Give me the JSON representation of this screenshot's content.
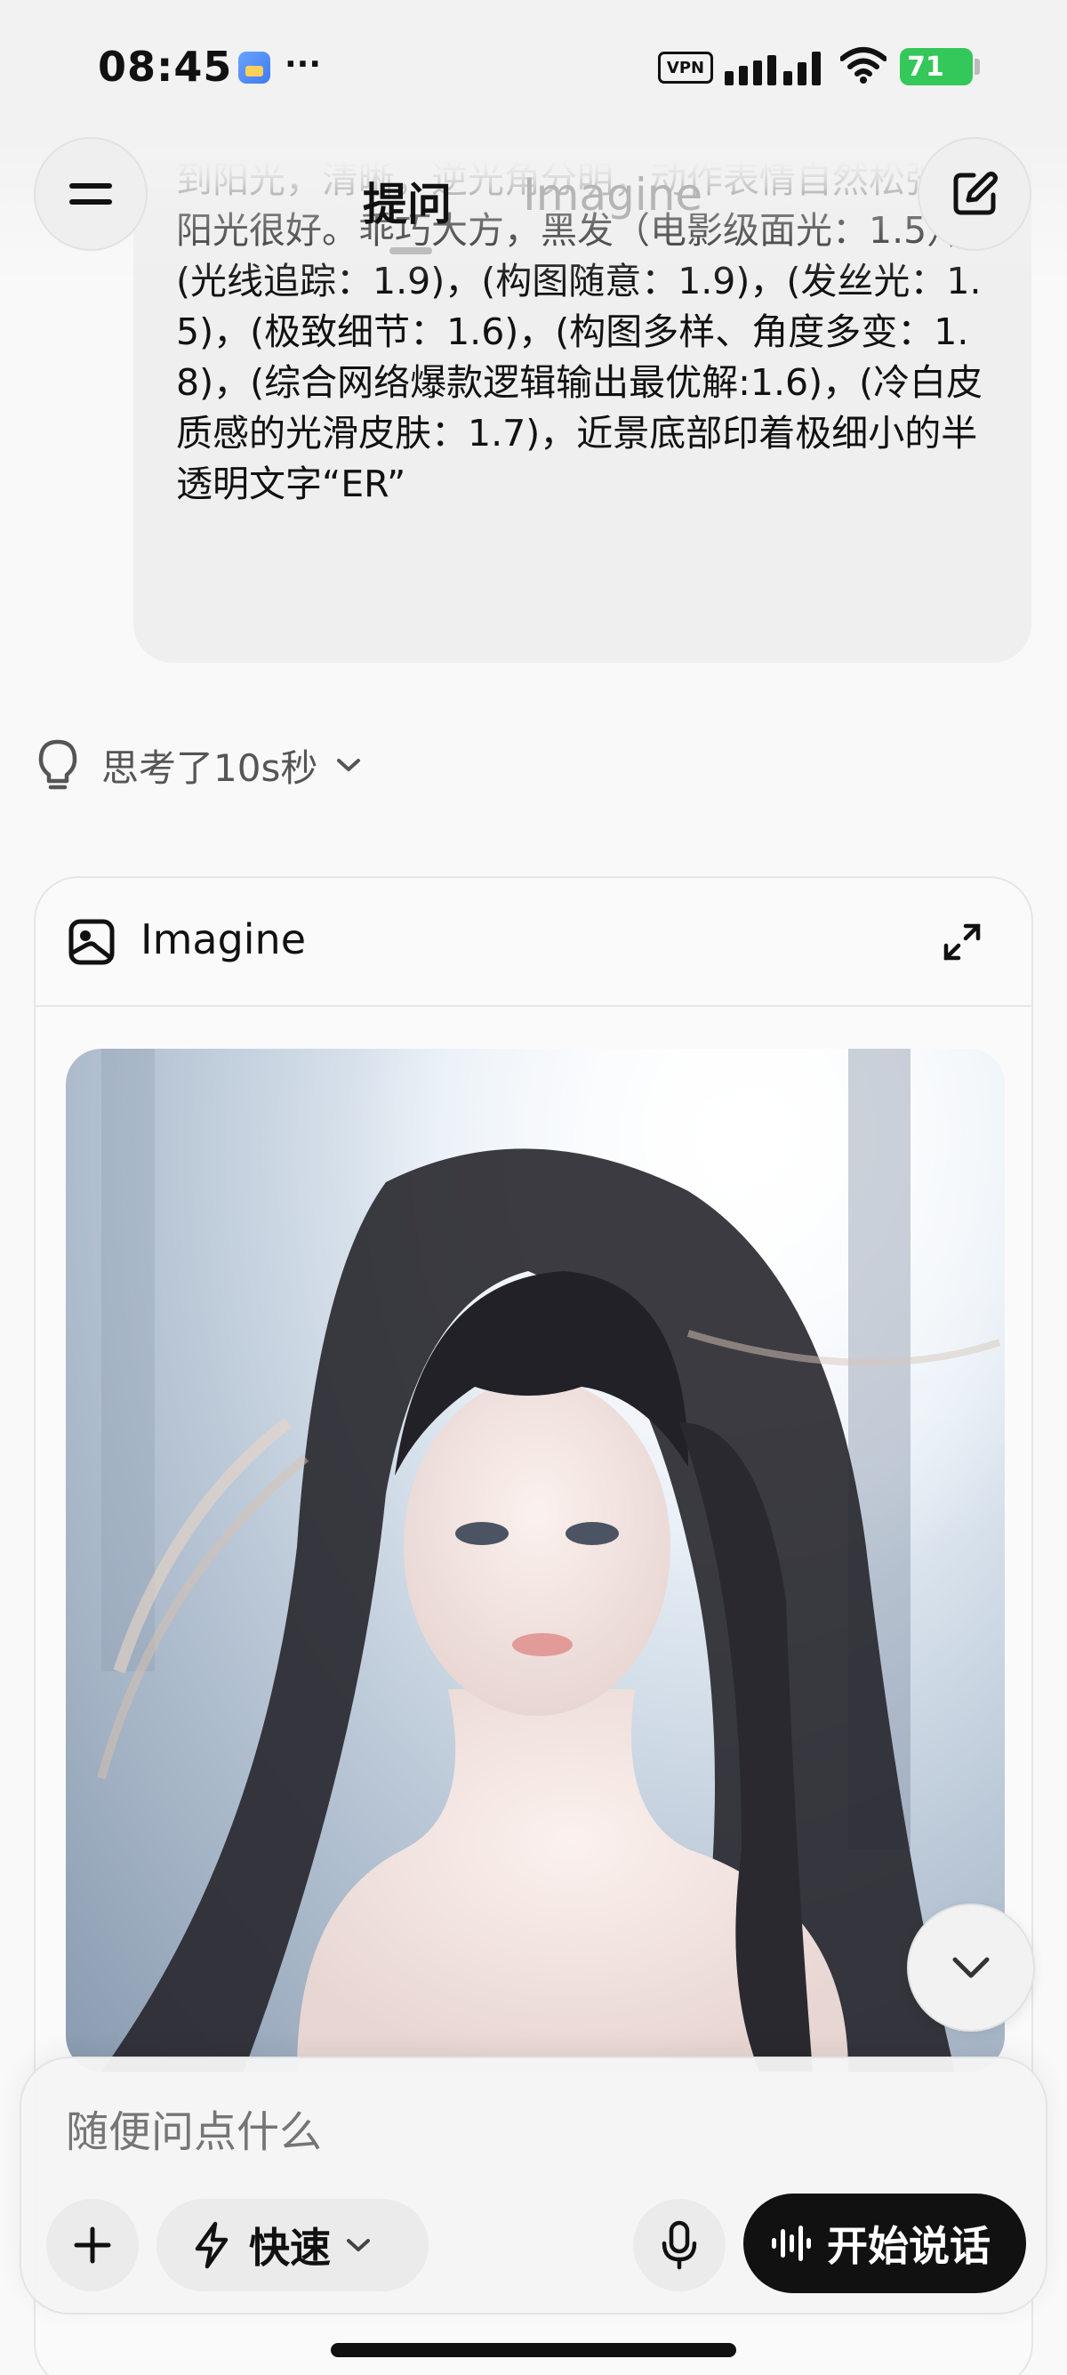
{
  "status_bar": {
    "time": "08:45",
    "more": "···",
    "vpn": "VPN",
    "battery": "71"
  },
  "nav": {
    "tabs": [
      {
        "label": "提问",
        "active": true
      },
      {
        "label": "Imagine",
        "active": false
      }
    ],
    "menu_icon": "hamburger-icon",
    "edit_icon": "edit-icon"
  },
  "prompt": {
    "text": "到阳光，清晰，逆光角分明，动作表情自然松弛，阳光很好。乖巧大方，黑发（电影级面光：1.5），(光线追踪：1.9)，(构图随意：1.9)，(发丝光：1.5)，(极致细节：1.6)，(构图多样、角度多变：1.8)，(综合网络爆款逻辑输出最优解:1.6)，(冷白皮质感的光滑皮肤：1.7)，近景底部印着极细小的半透明文字“ER”"
  },
  "thinking": {
    "label": "思考了10s秒",
    "icon": "lightbulb-icon"
  },
  "imagine_card": {
    "title": "Imagine",
    "icon": "imagine-icon",
    "expand_icon": "expand-icon"
  },
  "composer": {
    "placeholder": "随便问点什么",
    "speed_label": "快速",
    "voice_label": "开始说话"
  },
  "colors": {
    "background": "#f9f9f9",
    "bubble": "#efefef",
    "voice_button": "#111111",
    "battery": "#34c759",
    "inactive_tab": "#b5b5b5"
  }
}
